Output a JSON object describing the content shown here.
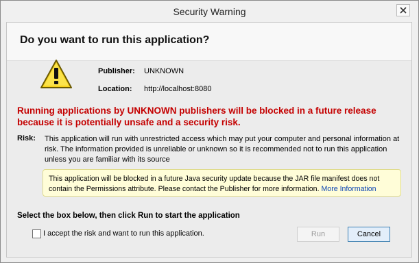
{
  "window": {
    "title": "Security Warning",
    "close_icon": "close-icon"
  },
  "dialog": {
    "heading": "Do you want to run this application?",
    "icon": "warning-icon",
    "publisher_label": "Publisher:",
    "publisher_value": "UNKNOWN",
    "location_label": "Location:",
    "location_value": "http://localhost:8080",
    "warning_line1": "Running applications by UNKNOWN publishers will be blocked in a future release",
    "warning_line2": "because it is potentially unsafe and a security risk.",
    "risk_label": "Risk:",
    "risk_text": "This application will run with unrestricted access which may put your computer and personal information at risk. The information provided is unreliable or unknown so it is recommended not to run this application unless you are familiar with its source",
    "notice_text": "This application will be blocked in a future Java security update because the JAR file manifest does not contain the Permissions attribute. Please contact the Publisher for more information.",
    "notice_link": "More Information",
    "instruction": "Select the box below, then click Run to start the application",
    "checkbox_label": "I accept the risk and want to run this application.",
    "checkbox_checked": false,
    "run_label": "Run",
    "cancel_label": "Cancel"
  },
  "colors": {
    "warning_text": "#c40000",
    "link": "#0b44b3",
    "notice_bg": "#fffdd8"
  }
}
